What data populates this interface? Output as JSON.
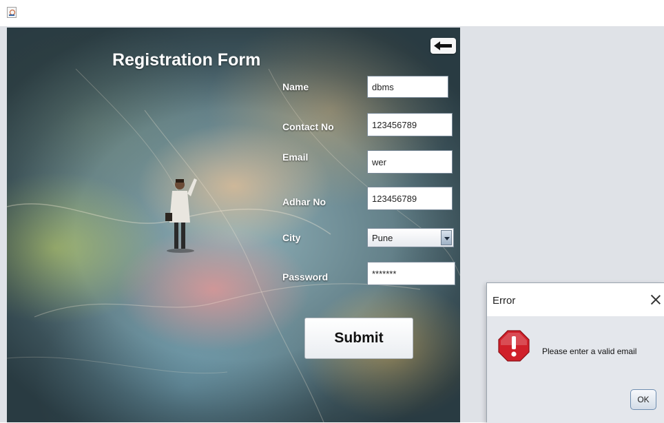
{
  "window": {
    "app_icon": "java-cup-icon"
  },
  "form": {
    "title": "Registration Form",
    "back_icon": "arrow-left-icon",
    "fields": {
      "name": {
        "label": "Name",
        "value": "dbms"
      },
      "contact": {
        "label": "Contact No",
        "value": "123456789"
      },
      "email": {
        "label": "Email",
        "value": "wer"
      },
      "adhar": {
        "label": "Adhar No",
        "value": "123456789"
      },
      "city": {
        "label": "City",
        "value": "Pune"
      },
      "password": {
        "label": "Password",
        "value": "*******"
      }
    },
    "submit_label": "Submit"
  },
  "dialog": {
    "title": "Error",
    "message": "Please enter a valid email",
    "ok_label": "OK",
    "icon": "error-icon"
  },
  "colors": {
    "panel_bg": "#dfe2e7",
    "dialog_body": "#e4e7ec",
    "error_red": "#d0202a"
  }
}
